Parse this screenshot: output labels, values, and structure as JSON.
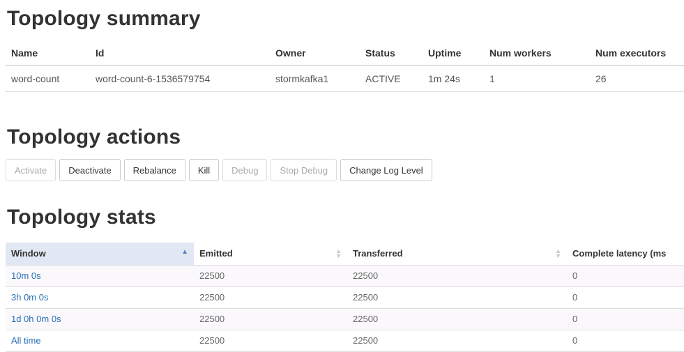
{
  "summary": {
    "title": "Topology summary",
    "headers": [
      "Name",
      "Id",
      "Owner",
      "Status",
      "Uptime",
      "Num workers",
      "Num executors"
    ],
    "row": [
      "word-count",
      "word-count-6-1536579754",
      "stormkafka1",
      "ACTIVE",
      "1m 24s",
      "1",
      "26"
    ]
  },
  "actions": {
    "title": "Topology actions",
    "buttons": [
      {
        "label": "Activate",
        "enabled": false
      },
      {
        "label": "Deactivate",
        "enabled": true
      },
      {
        "label": "Rebalance",
        "enabled": true
      },
      {
        "label": "Kill",
        "enabled": true
      },
      {
        "label": "Debug",
        "enabled": false
      },
      {
        "label": "Stop Debug",
        "enabled": false
      },
      {
        "label": "Change Log Level",
        "enabled": true
      }
    ]
  },
  "stats": {
    "title": "Topology stats",
    "headers": [
      "Window",
      "Emitted",
      "Transferred",
      "Complete latency (ms"
    ],
    "sorted_column": "Window",
    "sort_direction": "ascending",
    "rows": [
      {
        "window": "10m 0s",
        "emitted": "22500",
        "transferred": "22500",
        "latency": "0"
      },
      {
        "window": "3h 0m 0s",
        "emitted": "22500",
        "transferred": "22500",
        "latency": "0"
      },
      {
        "window": "1d 0h 0m 0s",
        "emitted": "22500",
        "transferred": "22500",
        "latency": "0"
      },
      {
        "window": "All time",
        "emitted": "22500",
        "transferred": "22500",
        "latency": "0"
      }
    ]
  },
  "colors": {
    "link": "#2a6fb7",
    "sorted_header_bg": "#e1e8f3",
    "row_stripe": "#fbf8fc"
  }
}
